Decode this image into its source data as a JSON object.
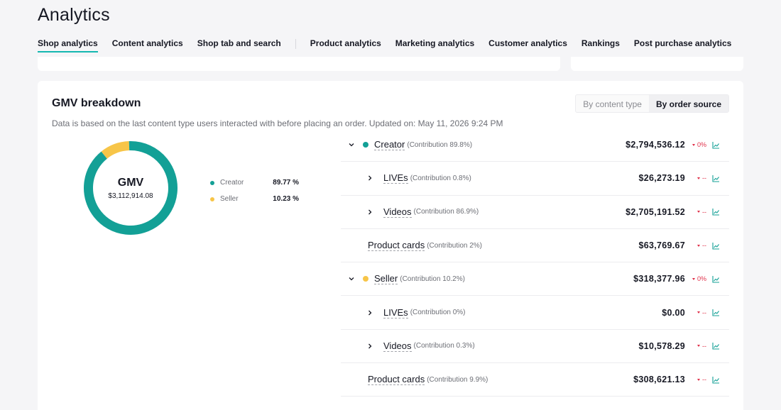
{
  "page": {
    "title": "Analytics"
  },
  "tabs": [
    {
      "label": "Shop analytics",
      "active": true
    },
    {
      "label": "Content analytics"
    },
    {
      "label": "Shop tab and search"
    },
    {
      "label": "Product analytics"
    },
    {
      "label": "Marketing analytics"
    },
    {
      "label": "Customer analytics"
    },
    {
      "label": "Rankings"
    },
    {
      "label": "Post purchase analytics"
    }
  ],
  "gmv": {
    "title": "GMV breakdown",
    "description": "Data is based on the last content type users interacted with before placing an order.  Updated on: May 11, 2026 9:24 PM",
    "toggle": {
      "option1": "By content type",
      "option2": "By order source",
      "active": "By order source"
    },
    "donut": {
      "label": "GMV",
      "value": "$3,112,914.08",
      "segments": [
        {
          "name": "Creator",
          "fraction": 0.8977,
          "color": "#13a096"
        },
        {
          "name": "Seller",
          "fraction": 0.1023,
          "color": "#f7c548"
        }
      ]
    },
    "legend": [
      {
        "name": "Creator",
        "pct": "89.77 %",
        "color": "#13a096"
      },
      {
        "name": "Seller",
        "pct": "10.23 %",
        "color": "#f7c548"
      }
    ],
    "rows": [
      {
        "name": "Creator",
        "contribution": "(Contribution 89.8%)",
        "amount": "$2,794,536.12",
        "change": "0%",
        "level": 0,
        "dot_color": "#13a096"
      },
      {
        "name": "LIVEs",
        "contribution": "(Contribution 0.8%)",
        "amount": "$26,273.19",
        "change": "--",
        "level": 1
      },
      {
        "name": "Videos",
        "contribution": "(Contribution 86.9%)",
        "amount": "$2,705,191.52",
        "change": "--",
        "level": 1
      },
      {
        "name": "Product cards",
        "contribution": "(Contribution 2%)",
        "amount": "$63,769.67",
        "change": "--",
        "level": 2
      },
      {
        "name": "Seller",
        "contribution": "(Contribution 10.2%)",
        "amount": "$318,377.96",
        "change": "0%",
        "level": 0,
        "dot_color": "#f7c548"
      },
      {
        "name": "LIVEs",
        "contribution": "(Contribution 0%)",
        "amount": "$0.00",
        "change": "--",
        "level": 1
      },
      {
        "name": "Videos",
        "contribution": "(Contribution 0.3%)",
        "amount": "$10,578.29",
        "change": "--",
        "level": 1
      },
      {
        "name": "Product cards",
        "contribution": "(Contribution 9.9%)",
        "amount": "$308,621.13",
        "change": "--",
        "level": 2
      }
    ]
  }
}
